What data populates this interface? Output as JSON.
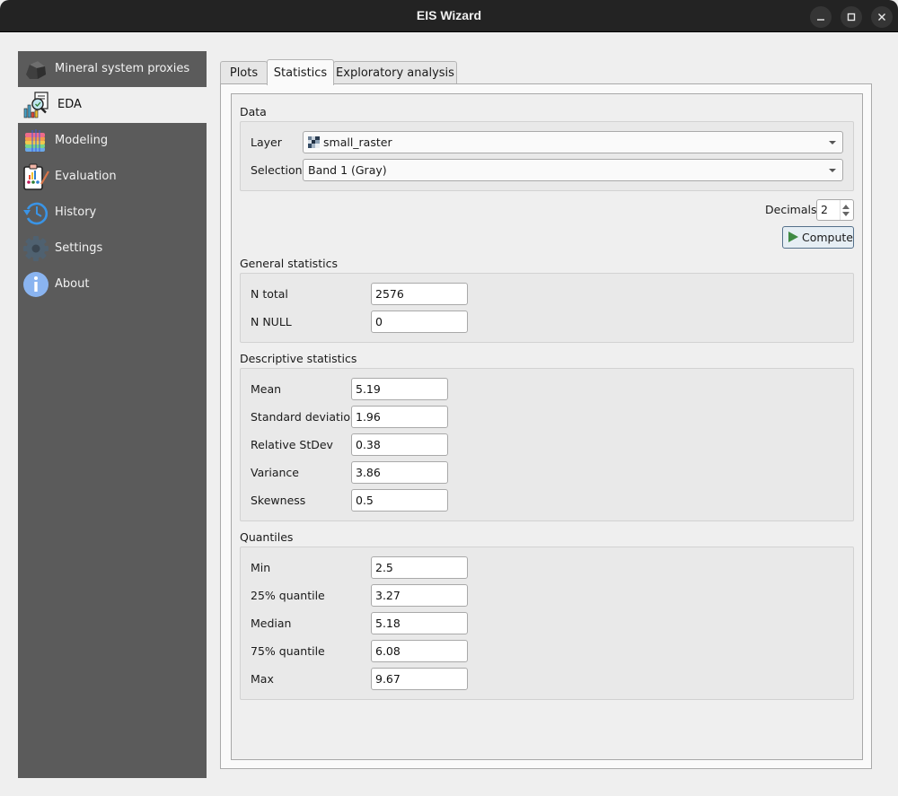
{
  "window": {
    "title": "EIS Wizard",
    "controls": [
      "minimize",
      "maximize",
      "close"
    ]
  },
  "sidebar": {
    "items": [
      {
        "label": "Mineral system proxies",
        "icon": "rock-icon",
        "active": false
      },
      {
        "label": "EDA",
        "icon": "chart-magnifier-icon",
        "active": true
      },
      {
        "label": "Modeling",
        "icon": "layers-stack-icon",
        "active": false
      },
      {
        "label": "Evaluation",
        "icon": "clipboard-chart-icon",
        "active": false
      },
      {
        "label": "History",
        "icon": "history-clock-icon",
        "active": false
      },
      {
        "label": "Settings",
        "icon": "gear-icon",
        "active": false
      },
      {
        "label": "About",
        "icon": "info-icon",
        "active": false
      }
    ]
  },
  "tabs": [
    {
      "label": "Plots",
      "active": false
    },
    {
      "label": "Statistics",
      "active": true
    },
    {
      "label": "Exploratory analysis",
      "active": false
    }
  ],
  "data_section": {
    "title": "Data",
    "layer_label": "Layer",
    "layer_value": "small_raster",
    "selection_label": "Selection",
    "selection_value": "Band 1 (Gray)"
  },
  "controls": {
    "decimals_label": "Decimals",
    "decimals_value": "2",
    "compute_label": "Compute"
  },
  "general_statistics": {
    "title": "General statistics",
    "rows": [
      {
        "label": "N total",
        "value": "2576"
      },
      {
        "label": "N NULL",
        "value": "0"
      }
    ]
  },
  "descriptive_statistics": {
    "title": "Descriptive statistics",
    "rows": [
      {
        "label": "Mean",
        "value": "5.19"
      },
      {
        "label": "Standard deviation",
        "value": "1.96"
      },
      {
        "label": "Relative StDev",
        "value": "0.38"
      },
      {
        "label": "Variance",
        "value": "3.86"
      },
      {
        "label": "Skewness",
        "value": "0.5"
      }
    ]
  },
  "quantiles": {
    "title": "Quantiles",
    "rows": [
      {
        "label": "Min",
        "value": "2.5"
      },
      {
        "label": "25% quantile",
        "value": "3.27"
      },
      {
        "label": "Median",
        "value": "5.18"
      },
      {
        "label": "75% quantile",
        "value": "6.08"
      },
      {
        "label": "Max",
        "value": "9.67"
      }
    ]
  },
  "colors": {
    "titlebar": "#232323",
    "sidebar": "#5b5b5b",
    "compute_play": "#3f8a43",
    "compute_border": "#55708a"
  }
}
